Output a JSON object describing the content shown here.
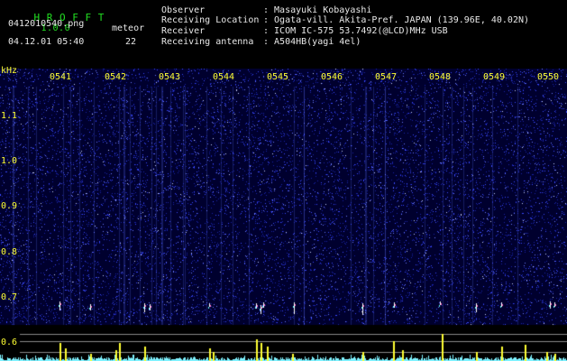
{
  "header": {
    "app_name": "H R O F F T",
    "version": "1.0.0",
    "filename": "0412010540.png",
    "datetime": "04.12.01 05:40",
    "meteor_label": "meteor",
    "meteor_count": "22"
  },
  "station_info": [
    {
      "label": "Observer",
      "value": ": Masayuki Kobayashi"
    },
    {
      "label": "Receiving Location",
      "value": ": Ogata-vill. Akita-Pref. JAPAN (139.96E, 40.02N)"
    },
    {
      "label": "Receiver",
      "value": ": ICOM IC-575 53.7492(@LCD)MHz USB"
    },
    {
      "label": "Receiving antenna",
      "value": ": A504HB(yagi 4el)"
    }
  ],
  "spectrogram": {
    "freq_unit": "kHz",
    "freq_ticks": [
      "1.1",
      "1.0",
      "0.9",
      "0.8",
      "0.7",
      "0.6"
    ],
    "time_ticks": [
      "0541",
      "0542",
      "0543",
      "0544",
      "0545",
      "0546",
      "0547",
      "0548",
      "0549",
      "0550"
    ],
    "colors": {
      "background": "#00002e",
      "noise": "#3a4aff",
      "signal": "#ffffff",
      "peaks": "#ffff33",
      "baseline": "#7ff2ff"
    }
  }
}
